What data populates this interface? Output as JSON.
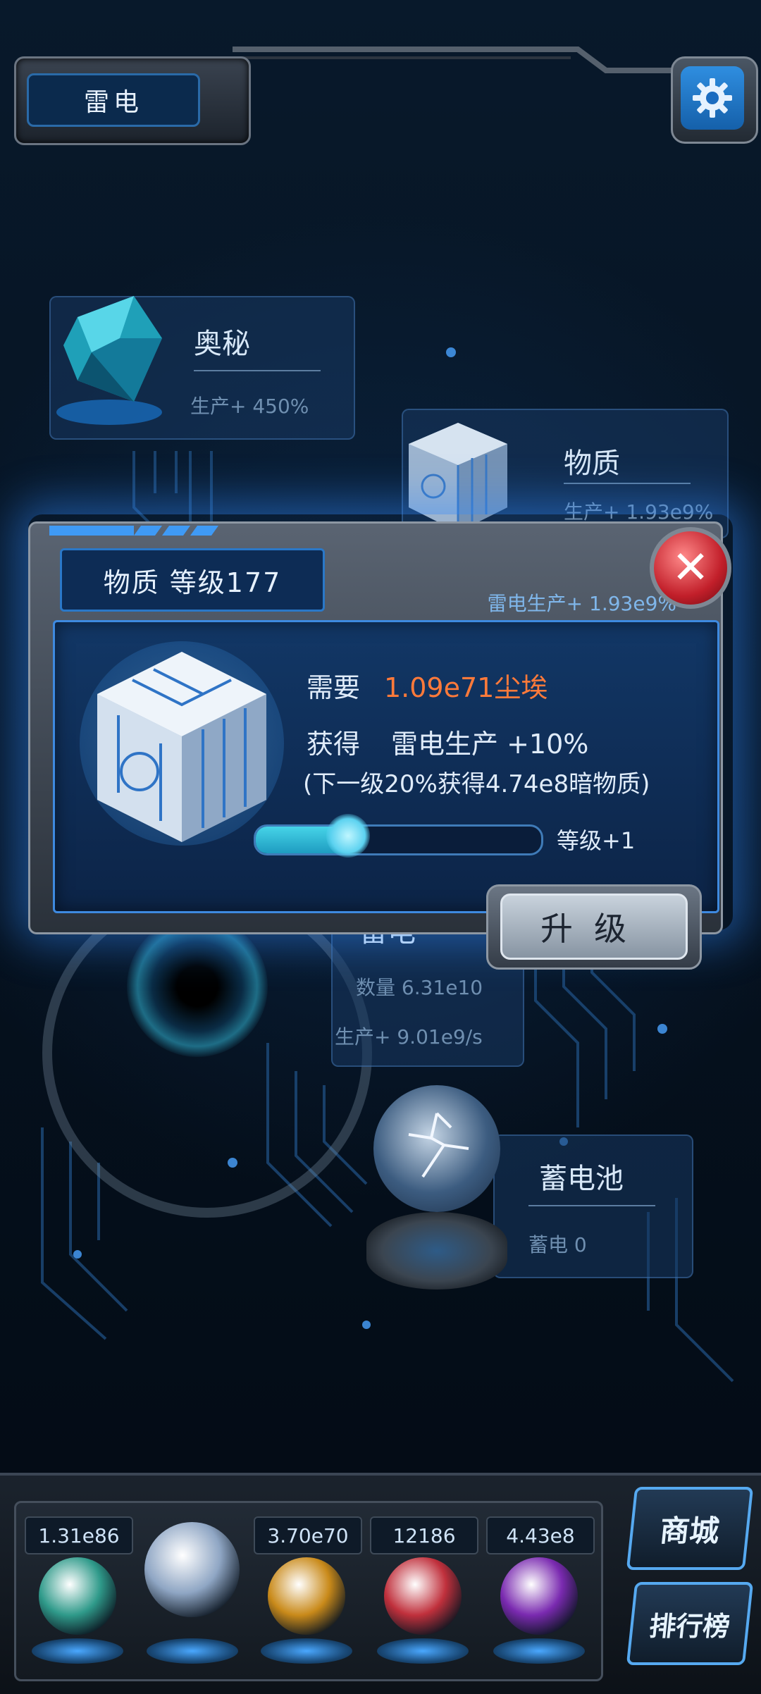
{
  "header": {
    "location": "雷电"
  },
  "buildings": {
    "mystery": {
      "name": "奥秘",
      "stat": "生产+ 450%"
    },
    "matter": {
      "name": "物质",
      "stat": "生产+ 1.93e9%"
    },
    "blackhole": {
      "name": "雷电",
      "count": "数量 6.31e10",
      "stat": "生产+ 9.01e9/s"
    },
    "battery": {
      "name": "蓄电池",
      "stat": "蓄电 0"
    }
  },
  "dialog": {
    "title": "物质 等级177",
    "subtitle": "雷电生产+ 1.93e9%",
    "cost_label": "需要",
    "cost_value": "1.09e71尘埃",
    "gain_label": "获得",
    "gain_value": "雷电生产 +10%",
    "next_tier": "(下一级20%获得4.74e8暗物质)",
    "level_step": "等级+1",
    "progress": 0.33,
    "upgrade_label": "升级",
    "close_glyph": "✕"
  },
  "resources": [
    {
      "value": "1.31e86",
      "color": "#2f9a8a"
    },
    {
      "value": "",
      "color": "#8fa6c4"
    },
    {
      "value": "3.70e70",
      "color": "#c98a1a"
    },
    {
      "value": "12186",
      "color": "#c0303c"
    },
    {
      "value": "4.43e8",
      "color": "#7a2ab0"
    }
  ],
  "side": {
    "shop": "商城",
    "ranking": "排行榜"
  },
  "icons": {
    "settings": "gear-icon",
    "close": "close-icon"
  }
}
